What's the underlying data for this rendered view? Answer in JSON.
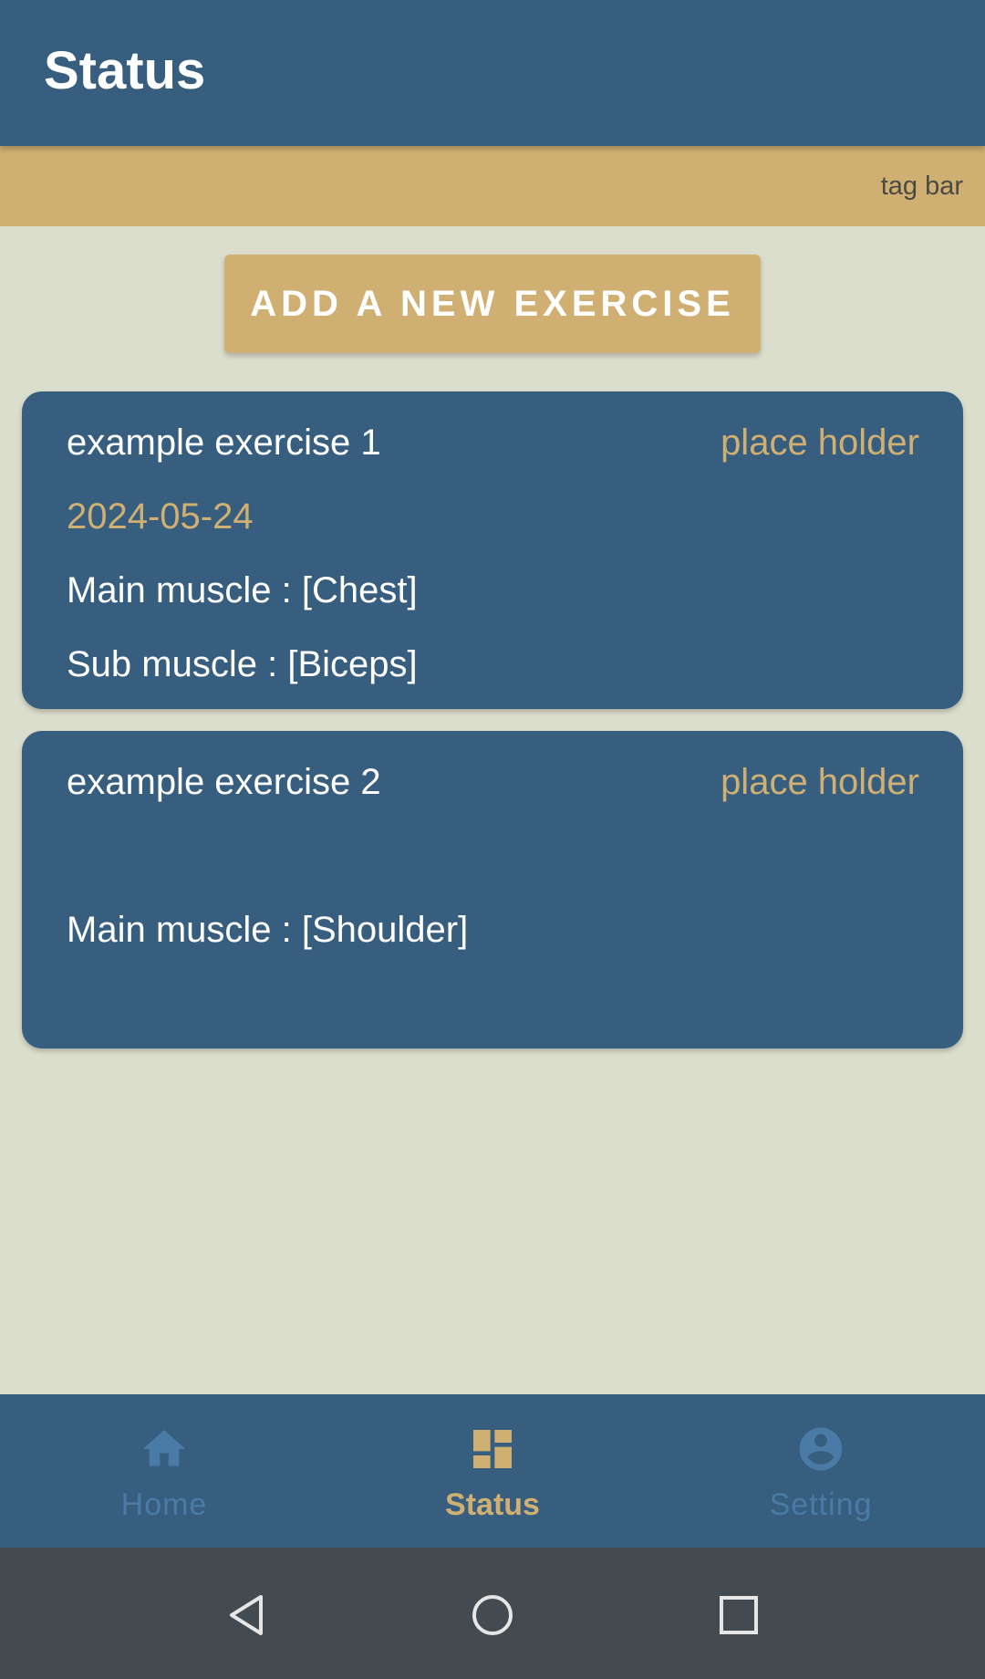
{
  "header": {
    "title": "Status"
  },
  "tag_bar": {
    "label": "tag bar"
  },
  "add_button": {
    "label": "ADD A NEW EXERCISE"
  },
  "exercises": [
    {
      "name": "example exercise 1",
      "tag": "place holder",
      "date": "2024-05-24",
      "main_muscle": "Main muscle : [Chest]",
      "sub_muscle": "Sub muscle : [Biceps]"
    },
    {
      "name": "example exercise 2",
      "tag": "place holder",
      "main_muscle": "Main muscle : [Shoulder]"
    }
  ],
  "bottom_nav": {
    "items": [
      {
        "label": "Home",
        "icon": "home-icon",
        "active": false
      },
      {
        "label": "Status",
        "icon": "dashboard-icon",
        "active": true
      },
      {
        "label": "Setting",
        "icon": "account-circle-icon",
        "active": false
      }
    ]
  },
  "colors": {
    "primary": "#375e7f",
    "accent": "#d0b072",
    "background": "#dcdecd",
    "inactive_nav": "#4a7aa6",
    "system_nav": "#434a50"
  },
  "system_nav": {
    "buttons": [
      "back-icon",
      "home-circle-icon",
      "recents-icon"
    ]
  }
}
